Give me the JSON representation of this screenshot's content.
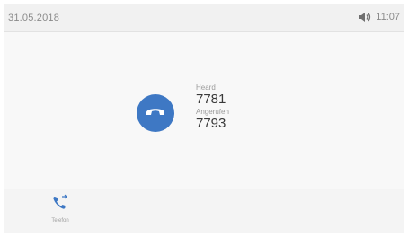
{
  "status_bar": {
    "date": "31.05.2018",
    "time": "11:07",
    "speaker_icon": "speaker-icon"
  },
  "call": {
    "icon": "hangup-phone-icon",
    "accent_color": "#3e78c4",
    "label_from": "Heard",
    "number_from": "7781",
    "label_to": "Angerufen",
    "number_to": "7793"
  },
  "bottom_bar": {
    "tab_icon": "phone-transfer-icon",
    "tab_label": "Telefon"
  }
}
